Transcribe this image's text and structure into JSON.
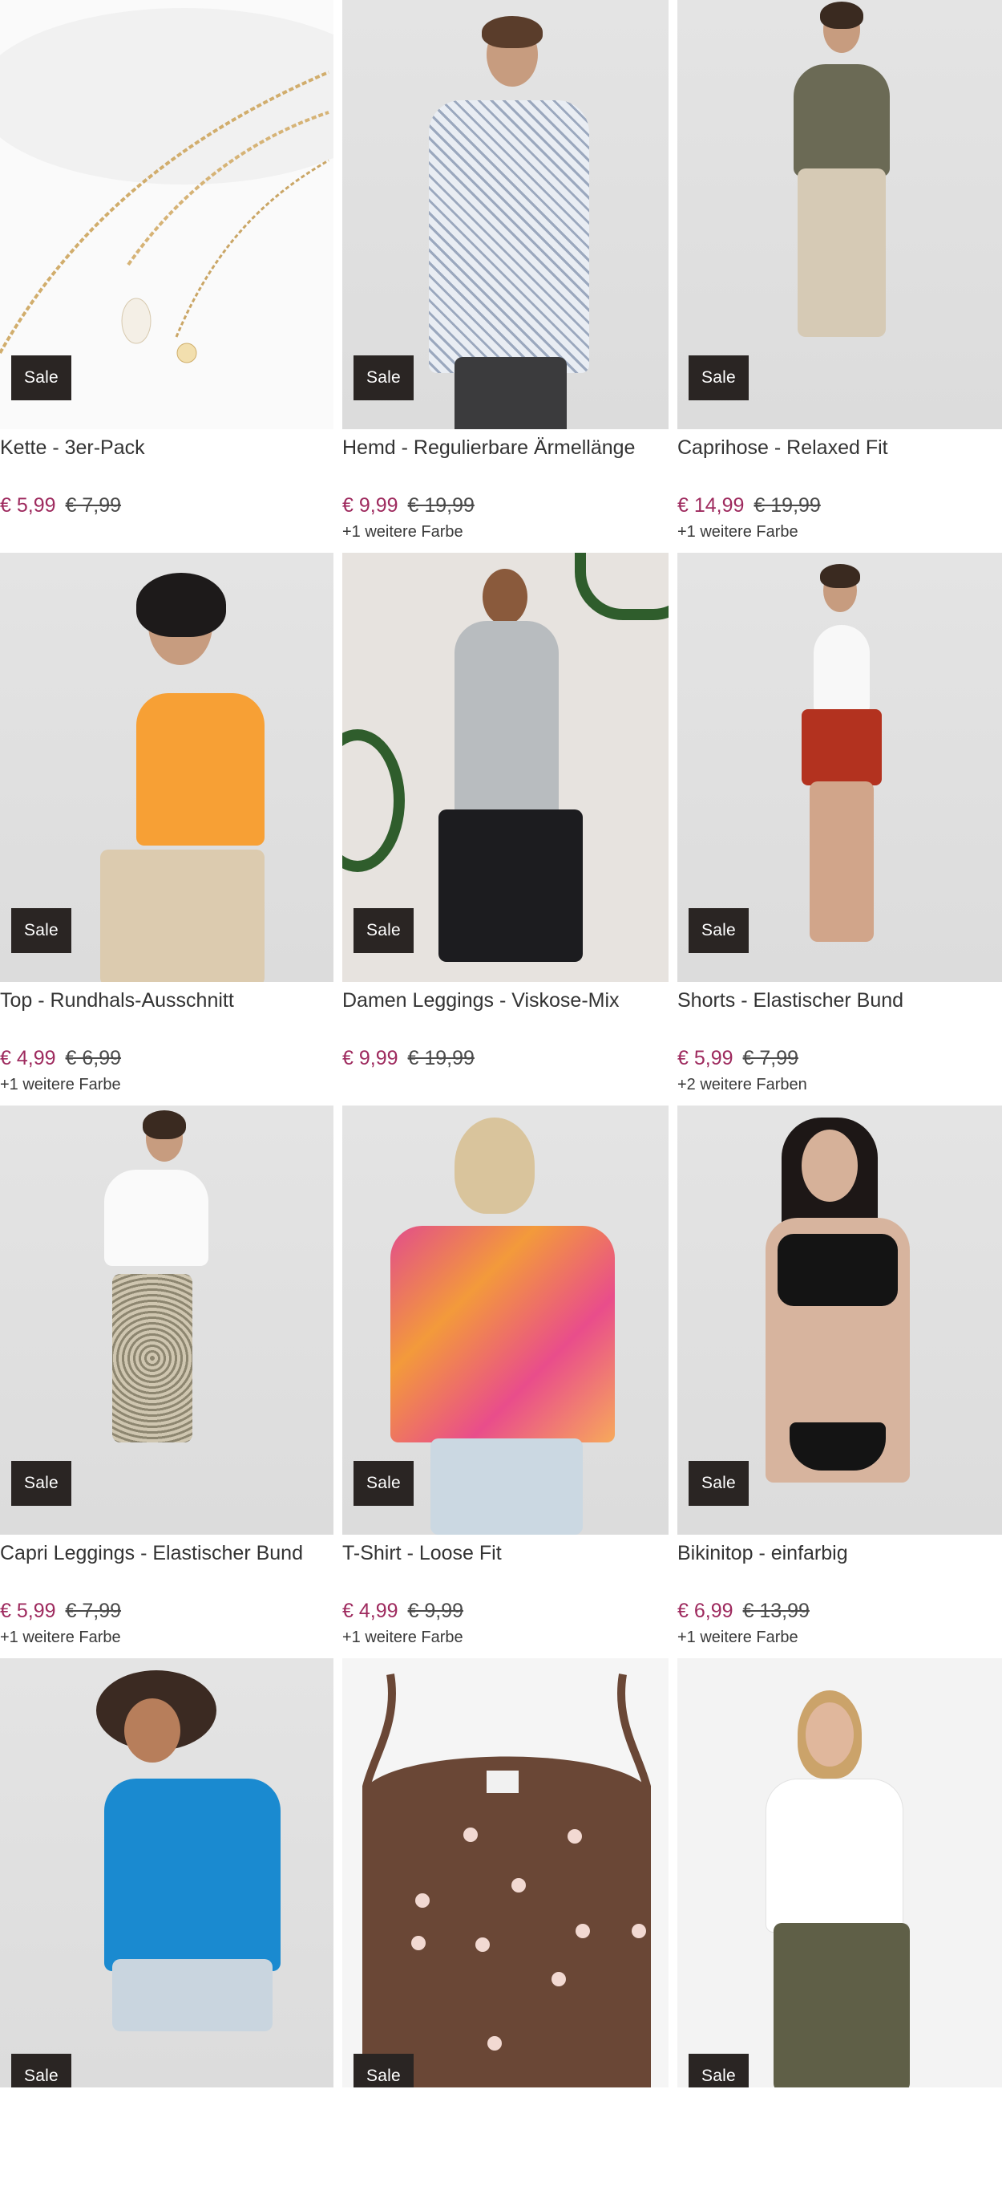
{
  "products": [
    {
      "title": "Kette - 3er-Pack",
      "badge": "Sale",
      "price_new": "€ 5,99",
      "price_old": "€ 7,99",
      "colors": ""
    },
    {
      "title": "Hemd - Regulierbare Ärmellänge",
      "badge": "Sale",
      "price_new": "€ 9,99",
      "price_old": "€ 19,99",
      "colors": "+1 weitere Farbe"
    },
    {
      "title": "Caprihose - Relaxed Fit",
      "badge": "Sale",
      "price_new": "€ 14,99",
      "price_old": "€ 19,99",
      "colors": "+1 weitere Farbe"
    },
    {
      "title": "Top - Rundhals-Ausschnitt",
      "badge": "Sale",
      "price_new": "€ 4,99",
      "price_old": "€ 6,99",
      "colors": "+1 weitere Farbe"
    },
    {
      "title": "Damen Leggings - Viskose-Mix",
      "badge": "Sale",
      "price_new": "€ 9,99",
      "price_old": "€ 19,99",
      "colors": ""
    },
    {
      "title": "Shorts - Elastischer Bund",
      "badge": "Sale",
      "price_new": "€ 5,99",
      "price_old": "€ 7,99",
      "colors": "+2 weitere Farben"
    },
    {
      "title": "Capri Leggings - Elastischer Bund",
      "badge": "Sale",
      "price_new": "€ 5,99",
      "price_old": "€ 7,99",
      "colors": "+1 weitere Farbe"
    },
    {
      "title": "T-Shirt - Loose Fit",
      "badge": "Sale",
      "price_new": "€ 4,99",
      "price_old": "€ 9,99",
      "colors": "+1 weitere Farbe"
    },
    {
      "title": "Bikinitop - einfarbig",
      "badge": "Sale",
      "price_new": "€ 6,99",
      "price_old": "€ 13,99",
      "colors": "+1 weitere Farbe"
    },
    {
      "title": "",
      "badge": "Sale",
      "price_new": "",
      "price_old": "",
      "colors": ""
    },
    {
      "title": "",
      "badge": "Sale",
      "price_new": "",
      "price_old": "",
      "colors": ""
    },
    {
      "title": "",
      "badge": "Sale",
      "price_new": "",
      "price_old": "",
      "colors": ""
    }
  ],
  "colors": {
    "sale_price": "#9e2a5e",
    "badge_bg": "#2a2523"
  }
}
